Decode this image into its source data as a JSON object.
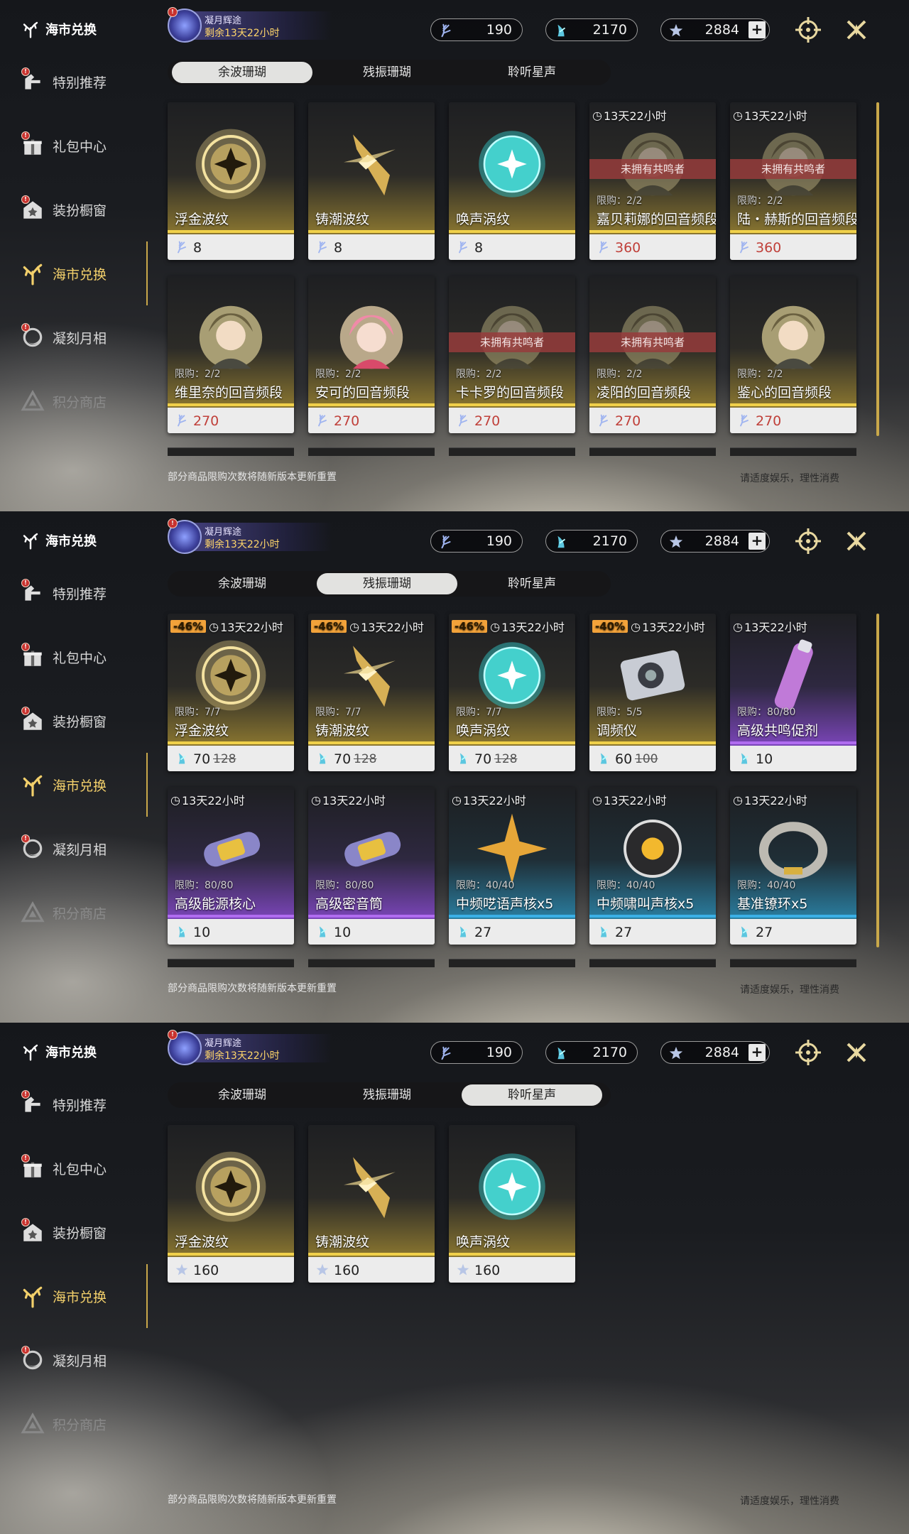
{
  "sidebar": {
    "title": "海市兑换",
    "items": [
      {
        "label": "特别推荐",
        "icon": "hand-icon",
        "badge": "!"
      },
      {
        "label": "礼包中心",
        "icon": "gift-icon",
        "badge": "!"
      },
      {
        "label": "装扮橱窗",
        "icon": "wardrobe-icon",
        "badge": "!"
      },
      {
        "label": "海市兑换",
        "icon": "coral-icon",
        "active": true
      },
      {
        "label": "凝刻月相",
        "icon": "moon-icon",
        "badge": "!"
      },
      {
        "label": "积分商店",
        "icon": "triangle-icon",
        "muted": true
      }
    ]
  },
  "event": {
    "title": "凝月辉途",
    "remaining": "剩余13天22小时",
    "badge": "!"
  },
  "currencies": [
    {
      "icon": "wave-coral-icon",
      "value": "190"
    },
    {
      "icon": "resonance-coral-icon",
      "value": "2170"
    },
    {
      "icon": "star-icon",
      "value": "2884"
    }
  ],
  "plus_label": "+",
  "tabs": [
    "余波珊瑚",
    "残振珊瑚",
    "聆听星声"
  ],
  "footer": {
    "note": "部分商品限购次数将随新版本更新重置",
    "tip": "请适度娱乐，理性消费"
  },
  "panels": [
    {
      "active_tab": 0,
      "cards": [
        {
          "name": "浮金波纹",
          "price": "8",
          "art": "gold-orb",
          "coin": "wave"
        },
        {
          "name": "铸潮波纹",
          "price": "8",
          "art": "gold-blade",
          "coin": "wave"
        },
        {
          "name": "唤声涡纹",
          "price": "8",
          "art": "teal-orb",
          "coin": "wave"
        },
        {
          "name": "嘉贝莉娜的回音频段",
          "price": "360",
          "timer": "13天22小时",
          "ribbon": "未拥有共鸣者",
          "limit": "限购：2/2",
          "art": "portrait",
          "coin": "wave",
          "red": true,
          "dim": true
        },
        {
          "name": "陆・赫斯的回音频段",
          "price": "360",
          "timer": "13天22小时",
          "ribbon": "未拥有共鸣者",
          "limit": "限购：2/2",
          "art": "portrait",
          "coin": "wave",
          "red": true,
          "dim": true
        },
        {
          "name": "维里奈的回音频段",
          "price": "270",
          "limit": "限购：2/2",
          "art": "portrait",
          "coin": "wave",
          "red": true
        },
        {
          "name": "安可的回音频段",
          "price": "270",
          "limit": "限购：2/2",
          "art": "portrait-pink",
          "coin": "wave",
          "red": true
        },
        {
          "name": "卡卡罗的回音频段",
          "price": "270",
          "ribbon": "未拥有共鸣者",
          "limit": "限购：2/2",
          "art": "portrait",
          "coin": "wave",
          "red": true,
          "dim": true
        },
        {
          "name": "凌阳的回音频段",
          "price": "270",
          "ribbon": "未拥有共鸣者",
          "limit": "限购：2/2",
          "art": "portrait",
          "coin": "wave",
          "red": true,
          "dim": true
        },
        {
          "name": "鉴心的回音频段",
          "price": "270",
          "limit": "限购：2/2",
          "art": "portrait",
          "coin": "wave",
          "red": true
        }
      ]
    },
    {
      "active_tab": 1,
      "cards": [
        {
          "name": "浮金波纹",
          "price": "70",
          "old": "128",
          "discount": "-46%",
          "timer": "13天22小时",
          "limit": "限购：7/7",
          "art": "gold-orb",
          "coin": "res"
        },
        {
          "name": "铸潮波纹",
          "price": "70",
          "old": "128",
          "discount": "-46%",
          "timer": "13天22小时",
          "limit": "限购：7/7",
          "art": "gold-blade",
          "coin": "res"
        },
        {
          "name": "唤声涡纹",
          "price": "70",
          "old": "128",
          "discount": "-46%",
          "timer": "13天22小时",
          "limit": "限购：7/7",
          "art": "teal-orb",
          "coin": "res"
        },
        {
          "name": "调频仪",
          "price": "60",
          "old": "100",
          "discount": "-40%",
          "timer": "13天22小时",
          "limit": "限购：5/5",
          "art": "device",
          "coin": "res"
        },
        {
          "name": "高级共鸣促剂",
          "price": "10",
          "timer": "13天22小时",
          "limit": "限购：80/80",
          "art": "vial",
          "coin": "res",
          "tier": "purple"
        },
        {
          "name": "高级能源核心",
          "price": "10",
          "timer": "13天22小时",
          "limit": "限购：80/80",
          "art": "capsule",
          "coin": "res",
          "tier": "purple"
        },
        {
          "name": "高级密音筒",
          "price": "10",
          "timer": "13天22小时",
          "limit": "限购：80/80",
          "art": "capsule",
          "coin": "res",
          "tier": "purple"
        },
        {
          "name": "中频呓语声核x5",
          "price": "27",
          "timer": "13天22小时",
          "limit": "限购：40/40",
          "art": "star",
          "coin": "res",
          "tier": "blue"
        },
        {
          "name": "中频啸叫声核x5",
          "price": "27",
          "timer": "13天22小时",
          "limit": "限购：40/40",
          "art": "core",
          "coin": "res",
          "tier": "blue"
        },
        {
          "name": "基准镣环x5",
          "price": "27",
          "timer": "13天22小时",
          "limit": "限购：40/40",
          "art": "ring",
          "coin": "res",
          "tier": "blue"
        }
      ]
    },
    {
      "active_tab": 2,
      "cards": [
        {
          "name": "浮金波纹",
          "price": "160",
          "art": "gold-orb",
          "coin": "star"
        },
        {
          "name": "铸潮波纹",
          "price": "160",
          "art": "gold-blade",
          "coin": "star"
        },
        {
          "name": "唤声涡纹",
          "price": "160",
          "art": "teal-orb",
          "coin": "star"
        }
      ]
    }
  ],
  "colors": {
    "accent": "#f3d06b",
    "gold_bar": "#f0d04a",
    "purple_bar": "#b06cf0",
    "blue_bar": "#3ab0e6",
    "ribbon": "#963c3c",
    "discount": "#f2a23a",
    "red_price": "#c0403a"
  }
}
